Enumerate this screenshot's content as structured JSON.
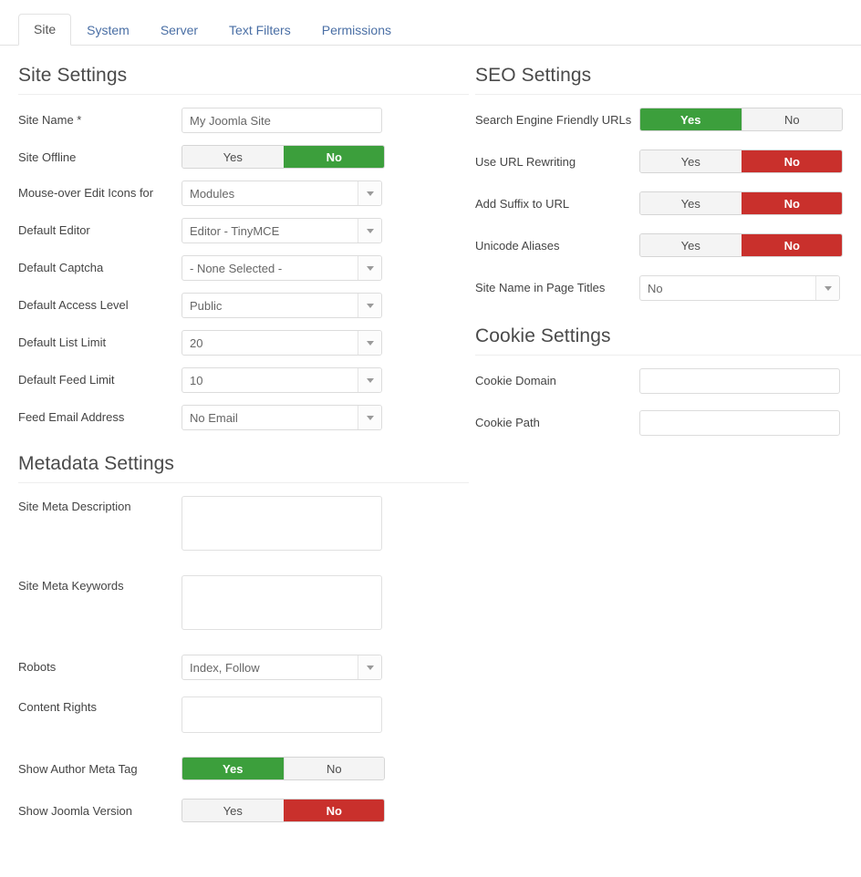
{
  "tabs": [
    {
      "label": "Site",
      "active": true
    },
    {
      "label": "System",
      "active": false
    },
    {
      "label": "Server",
      "active": false
    },
    {
      "label": "Text Filters",
      "active": false
    },
    {
      "label": "Permissions",
      "active": false
    }
  ],
  "colors": {
    "toggle_on_green": "#3c9f3c",
    "toggle_on_red": "#c9302c",
    "toggle_off": "#f4f4f4",
    "tab_link": "#4a6fa5",
    "heading": "#4a4a4a"
  },
  "toggle_options": {
    "yes": "Yes",
    "no": "No"
  },
  "site_settings": {
    "title": "Site Settings",
    "fields": {
      "site_name": {
        "label": "Site Name *",
        "value": "My Joomla Site"
      },
      "site_offline": {
        "label": "Site Offline",
        "selected": "No",
        "state_color": "green"
      },
      "mouseover_edit_icons": {
        "label": "Mouse-over Edit Icons for",
        "value": "Modules"
      },
      "default_editor": {
        "label": "Default Editor",
        "value": "Editor - TinyMCE"
      },
      "default_captcha": {
        "label": "Default Captcha",
        "value": "- None Selected -"
      },
      "default_access_level": {
        "label": "Default Access Level",
        "value": "Public"
      },
      "default_list_limit": {
        "label": "Default List Limit",
        "value": "20"
      },
      "default_feed_limit": {
        "label": "Default Feed Limit",
        "value": "10"
      },
      "feed_email_address": {
        "label": "Feed Email Address",
        "value": "No Email"
      }
    }
  },
  "metadata_settings": {
    "title": "Metadata Settings",
    "fields": {
      "site_meta_description": {
        "label": "Site Meta Description",
        "value": ""
      },
      "site_meta_keywords": {
        "label": "Site Meta Keywords",
        "value": ""
      },
      "robots": {
        "label": "Robots",
        "value": "Index, Follow"
      },
      "content_rights": {
        "label": "Content Rights",
        "value": ""
      },
      "show_author_meta_tag": {
        "label": "Show Author Meta Tag",
        "selected": "Yes",
        "state_color": "green"
      },
      "show_joomla_version": {
        "label": "Show Joomla Version",
        "selected": "No",
        "state_color": "red"
      }
    }
  },
  "seo_settings": {
    "title": "SEO Settings",
    "fields": {
      "sef_urls": {
        "label": "Search Engine Friendly URLs",
        "selected": "Yes",
        "state_color": "green"
      },
      "url_rewriting": {
        "label": "Use URL Rewriting",
        "selected": "No",
        "state_color": "red"
      },
      "add_suffix": {
        "label": "Add Suffix to URL",
        "selected": "No",
        "state_color": "red"
      },
      "unicode_aliases": {
        "label": "Unicode Aliases",
        "selected": "No",
        "state_color": "red"
      },
      "site_name_in_page_titles": {
        "label": "Site Name in Page Titles",
        "value": "No"
      }
    }
  },
  "cookie_settings": {
    "title": "Cookie Settings",
    "fields": {
      "cookie_domain": {
        "label": "Cookie Domain",
        "value": ""
      },
      "cookie_path": {
        "label": "Cookie Path",
        "value": ""
      }
    }
  }
}
